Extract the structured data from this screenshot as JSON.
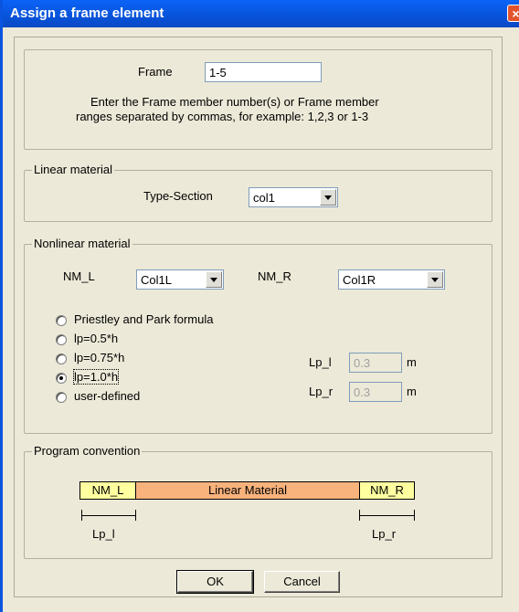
{
  "window": {
    "title": "Assign a frame element",
    "close_glyph": "×"
  },
  "frame": {
    "label": "Frame",
    "value": "1-5",
    "hint_line1": "Enter the Frame member number(s) or Frame member",
    "hint_line2": "ranges separated by commas, for example: 1,2,3 or 1-3"
  },
  "linear": {
    "legend": "Linear material",
    "type_label": "Type-Section",
    "type_value": "col1"
  },
  "nonlinear": {
    "legend": "Nonlinear material",
    "nml_label": "NM_L",
    "nml_value": "Col1L",
    "nmr_label": "NM_R",
    "nmr_value": "Col1R",
    "options": [
      "Priestley and Park formula",
      "lp=0.5*h",
      "lp=0.75*h",
      "lp=1.0*h",
      "user-defined"
    ],
    "selected_index": 3,
    "lpl_label": "Lp_l",
    "lpl_value": "0.3",
    "lpr_label": "Lp_r",
    "lpr_value": "0.3",
    "unit": "m"
  },
  "convention": {
    "legend": "Program convention",
    "left": "NM_L",
    "middle": "Linear Material",
    "right": "NM_R",
    "left_dim": "Lp_l",
    "right_dim": "Lp_r"
  },
  "buttons": {
    "ok": "OK",
    "cancel": "Cancel"
  },
  "colors": {
    "nm_fill": "#FFFFA0",
    "linear_fill": "#F8B27C",
    "titlebar": "#0853DA"
  }
}
